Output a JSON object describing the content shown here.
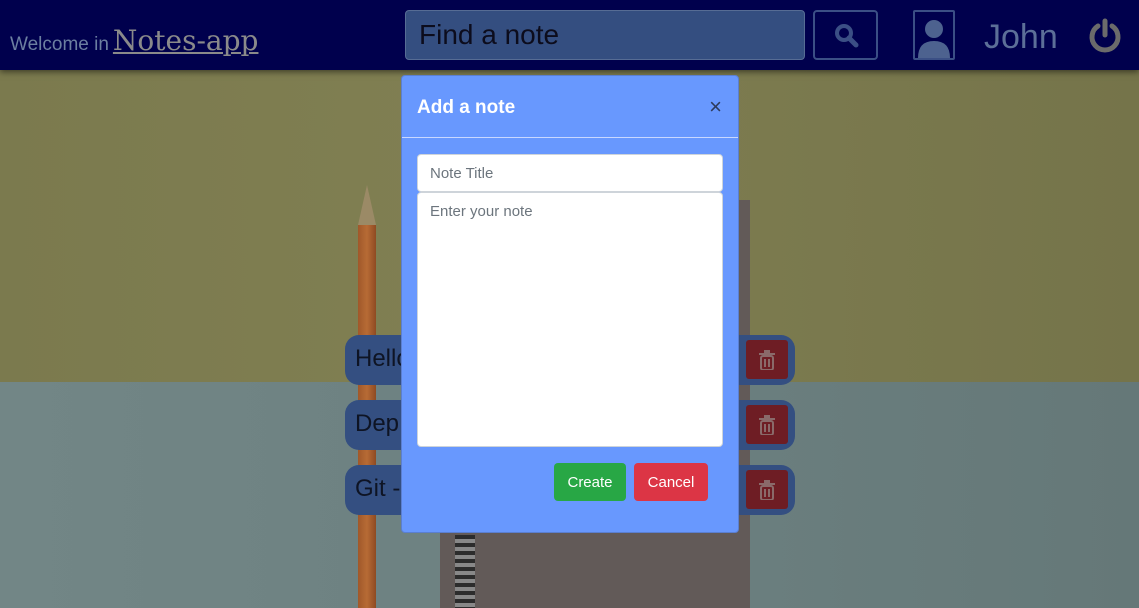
{
  "header": {
    "welcome": "Welcome in",
    "brand": "Notes-app",
    "search_placeholder": "Find a note",
    "username": "John"
  },
  "notes": [
    {
      "title": "Hello"
    },
    {
      "title": "Dep"
    },
    {
      "title": "Git -"
    }
  ],
  "modal": {
    "title": "Add a note",
    "close": "×",
    "title_placeholder": "Note Title",
    "body_placeholder": "Enter your note",
    "create": "Create",
    "cancel": "Cancel"
  },
  "colors": {
    "header": "#00004d",
    "modal": "#6898fe",
    "create": "#28a745",
    "cancel": "#dc3545"
  }
}
